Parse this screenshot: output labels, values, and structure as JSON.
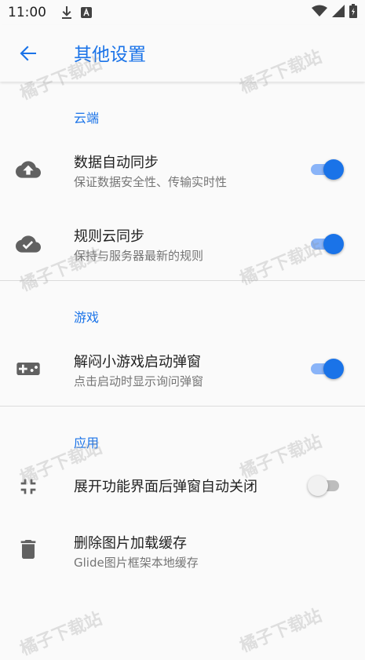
{
  "status_bar": {
    "time": "11:00"
  },
  "app_bar": {
    "title": "其他设置"
  },
  "sections": [
    {
      "title": "云端",
      "items": [
        {
          "title": "数据自动同步",
          "summary": "保证数据安全性、传输实时性",
          "checked": true
        },
        {
          "title": "规则云同步",
          "summary": "保持与服务器最新的规则",
          "checked": true
        }
      ]
    },
    {
      "title": "游戏",
      "items": [
        {
          "title": "解闷小游戏启动弹窗",
          "summary": "点击启动时显示询问弹窗",
          "checked": true
        }
      ]
    },
    {
      "title": "应用",
      "items": [
        {
          "title": "展开功能界面后弹窗自动关闭",
          "checked": false
        },
        {
          "title": "删除图片加载缓存",
          "summary": "Glide图片框架本地缓存"
        }
      ]
    }
  ],
  "watermark": "橘子下载站",
  "colors": {
    "accent": "#1a73e8",
    "accent_light": "#8ab4f8",
    "text_primary": "#212121",
    "text_secondary": "#757575",
    "icon": "#616161"
  },
  "icons": [
    "download-icon",
    "a-badge-icon",
    "wifi-icon",
    "signal-icon",
    "battery-icon",
    "back-arrow-icon",
    "cloud-upload-icon",
    "cloud-done-icon",
    "gamepad-icon",
    "collapse-icon",
    "trash-icon"
  ]
}
